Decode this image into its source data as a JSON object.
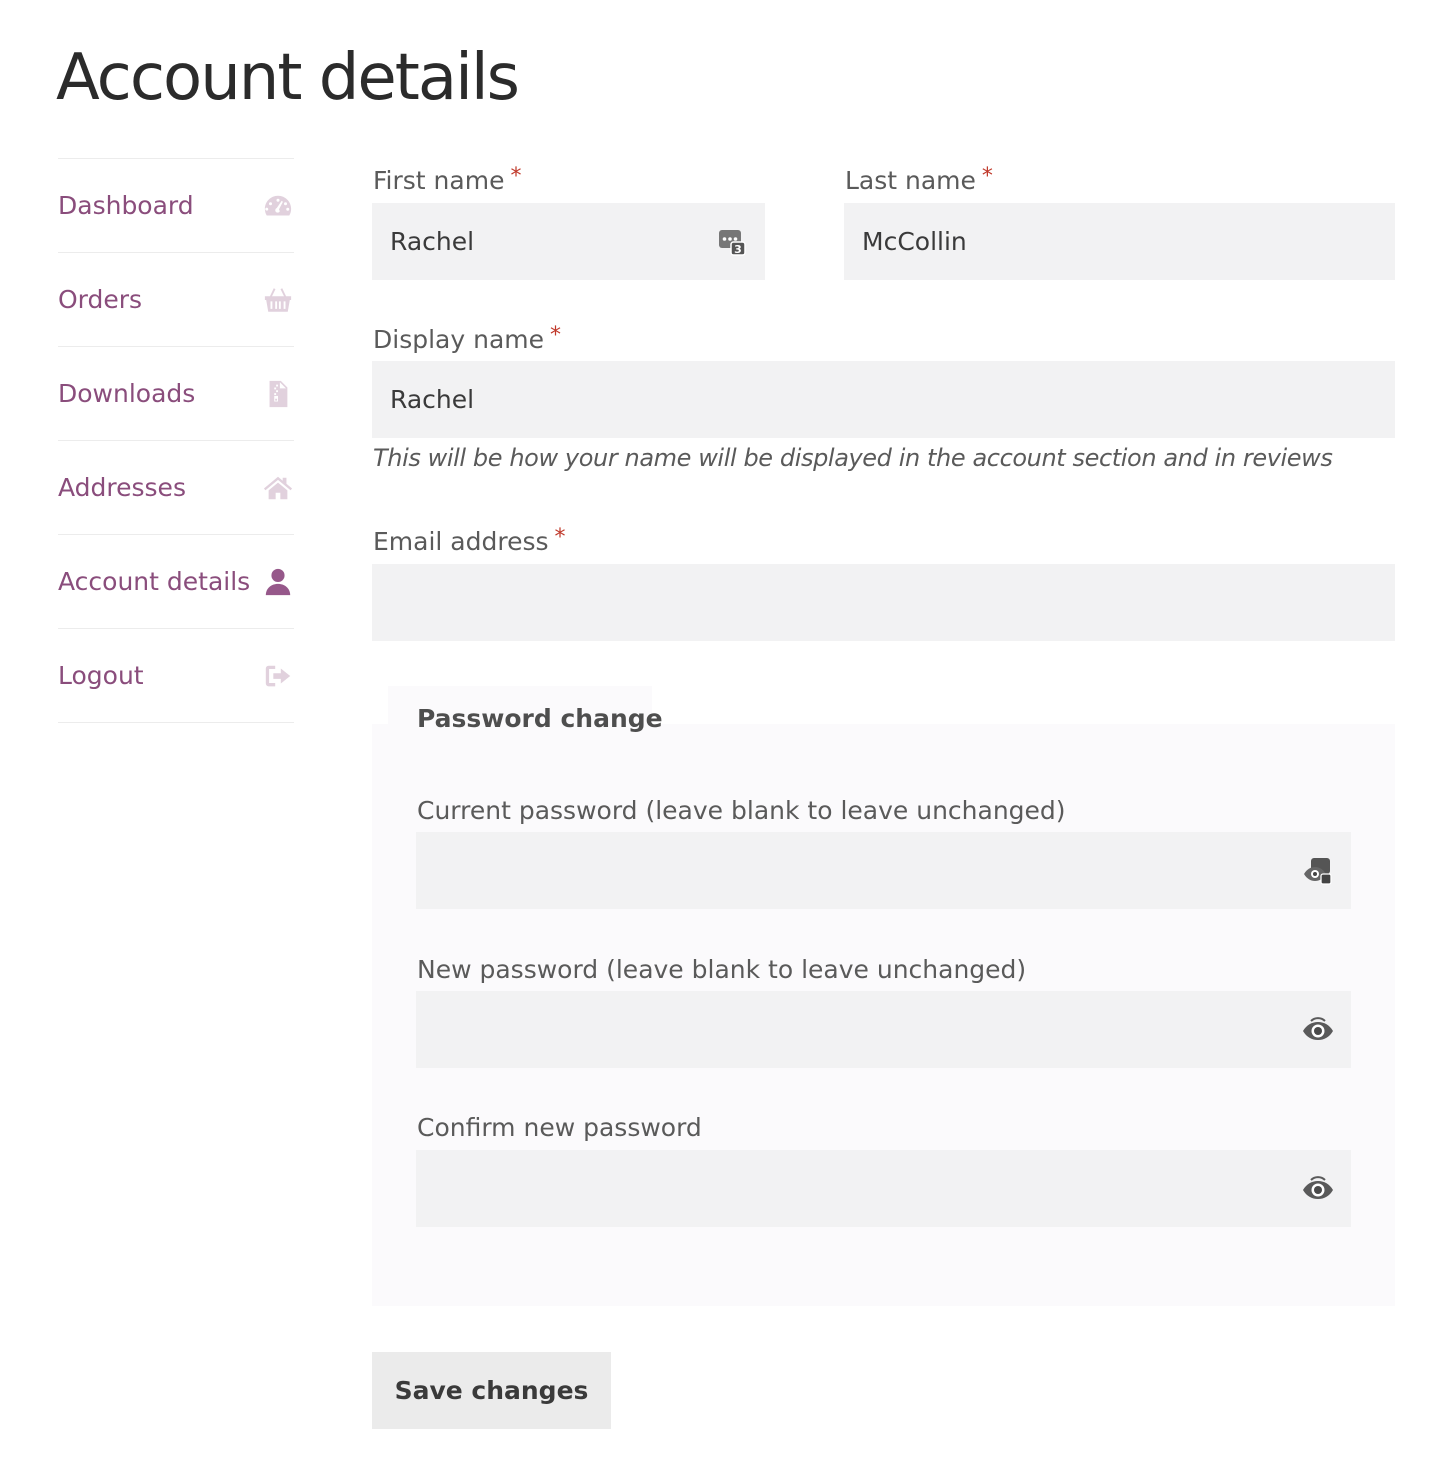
{
  "page": {
    "title": "Account details"
  },
  "sidebar": {
    "items": [
      {
        "label": "Dashboard",
        "icon": "dashboard-gauge-icon",
        "active": false
      },
      {
        "label": "Orders",
        "icon": "basket-icon",
        "active": false
      },
      {
        "label": "Downloads",
        "icon": "file-download-icon",
        "active": false
      },
      {
        "label": "Addresses",
        "icon": "home-icon",
        "active": false
      },
      {
        "label": "Account details",
        "icon": "user-icon",
        "active": true
      },
      {
        "label": "Logout",
        "icon": "sign-out-icon",
        "active": false
      }
    ]
  },
  "form": {
    "first_name": {
      "label": "First name",
      "required": "*",
      "value": "Rachel",
      "icon": "password-manager-icon"
    },
    "last_name": {
      "label": "Last name",
      "required": "*",
      "value": "McCollin"
    },
    "display_name": {
      "label": "Display name",
      "required": "*",
      "value": "Rachel",
      "hint": "This will be how your name will be displayed in the account section and in reviews"
    },
    "email": {
      "label": "Email address",
      "required": "*",
      "value": ""
    },
    "password_change": {
      "legend": "Password change",
      "current": {
        "label": "Current password (leave blank to leave unchanged)",
        "value": "",
        "icon": "password-manager-icon"
      },
      "new": {
        "label": "New password (leave blank to leave unchanged)",
        "value": "",
        "icon": "eye-icon"
      },
      "confirm": {
        "label": "Confirm new password",
        "value": "",
        "icon": "eye-icon"
      }
    },
    "save_label": "Save changes"
  },
  "colors": {
    "accent": "#96588a",
    "link": "#8a4d7c",
    "icon_muted": "#e1d1dd",
    "required": "#c0392b",
    "input_bg": "#f2f2f3",
    "fieldset_bg": "#fbfafc",
    "button_bg": "#ebebeb"
  }
}
